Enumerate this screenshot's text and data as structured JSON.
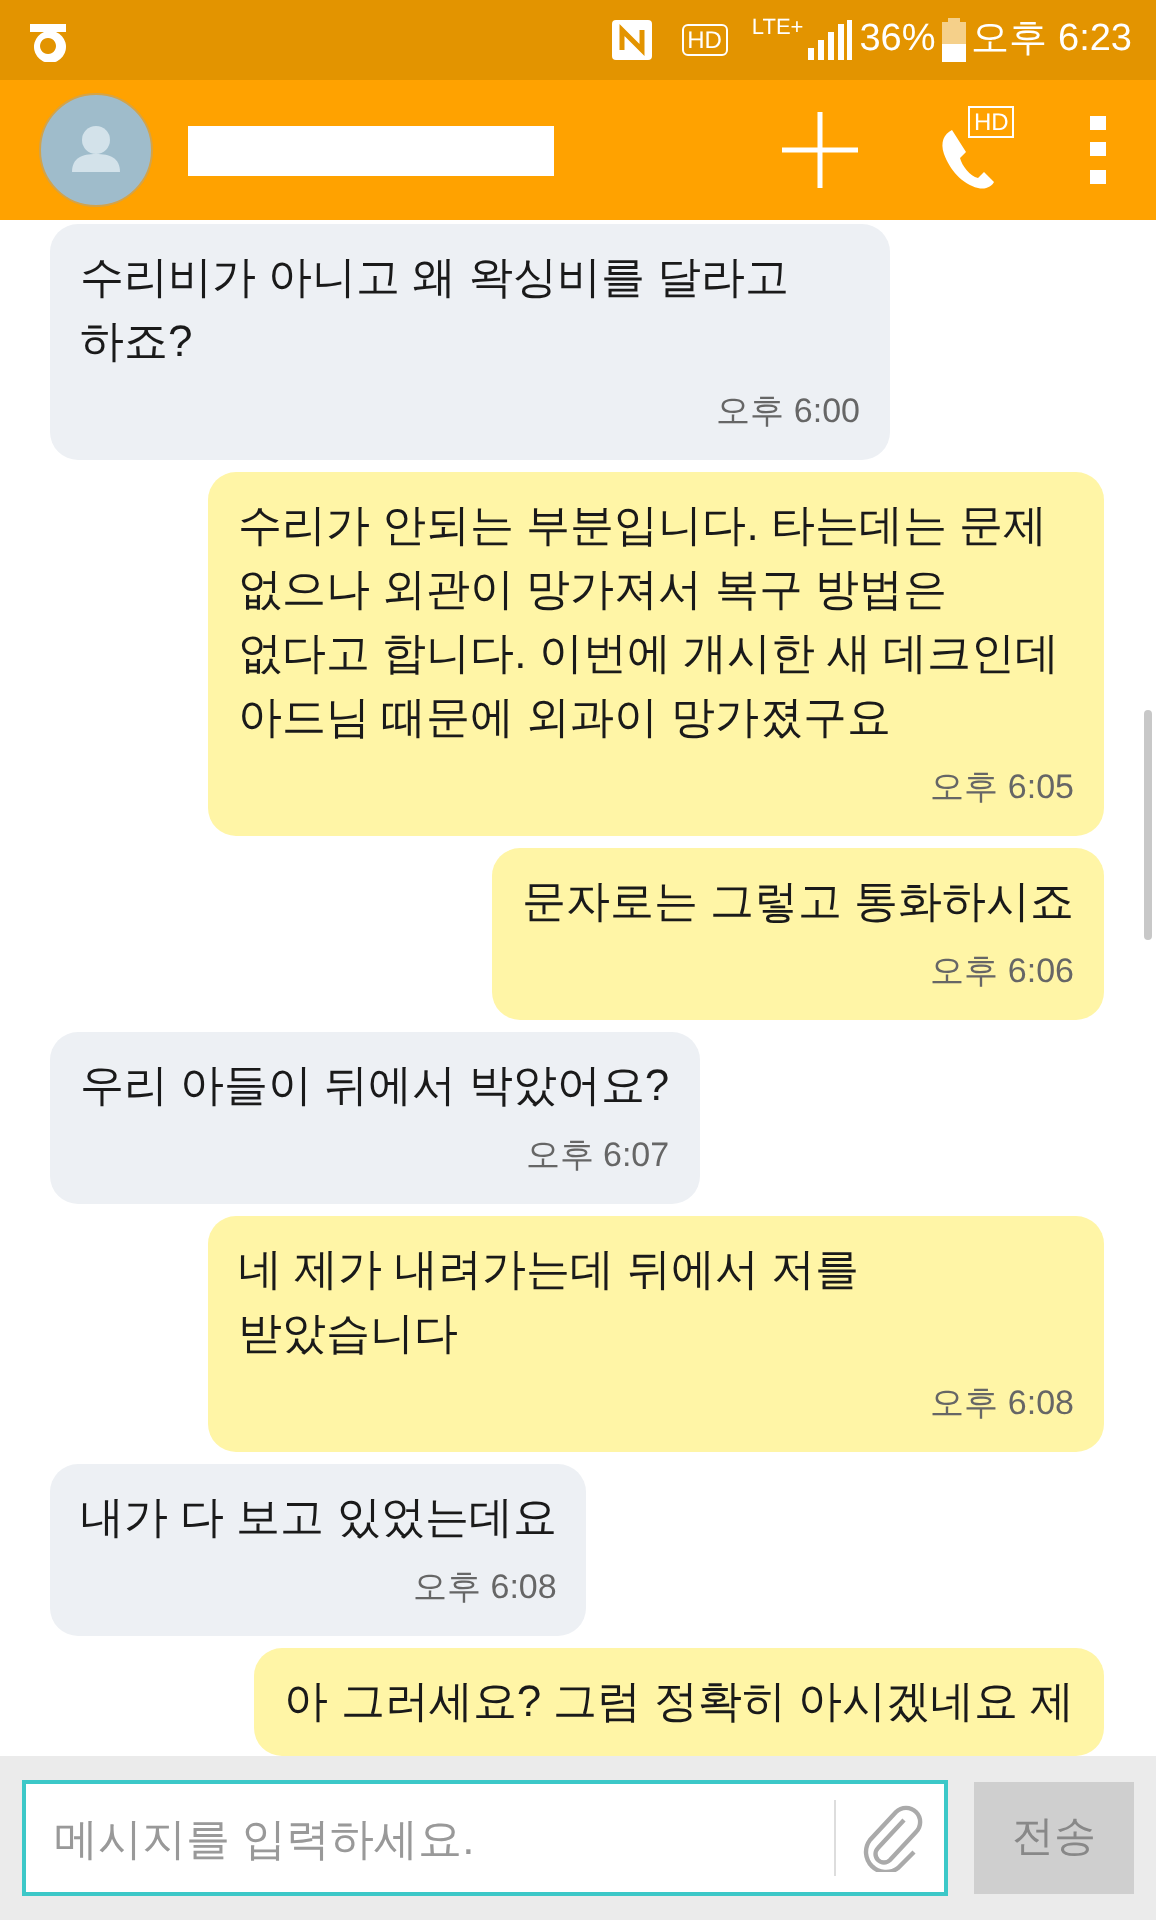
{
  "status_bar": {
    "hd": "HD",
    "network": "LTE+",
    "battery": "36%",
    "time": "오후 6:23"
  },
  "header": {
    "call_badge": "HD"
  },
  "messages": [
    {
      "kind": "received",
      "text": "수리비가 아니고 왜 왁싱비를 달라고 하죠?",
      "time": "오후 6:00"
    },
    {
      "kind": "sent",
      "text": "수리가 안되는 부분입니다. 타는데는 문제 없으나 외관이 망가져서 복구 방법은 없다고 합니다. 이번에 개시한 새 데크인데 아드님 때문에 외과이 망가졌구요",
      "time": "오후 6:05"
    },
    {
      "kind": "sent",
      "text": "문자로는 그렇고 통화하시죠",
      "time": "오후 6:06"
    },
    {
      "kind": "received",
      "text": "우리 아들이 뒤에서 박았어요?",
      "time": "오후 6:07"
    },
    {
      "kind": "sent",
      "text": "네 제가 내려가는데 뒤에서 저를 받았습니다",
      "time": "오후 6:08"
    },
    {
      "kind": "received",
      "text": "내가 다 보고 있었는데요",
      "time": "오후 6:08"
    },
    {
      "kind": "sent",
      "text": "아 그러세요? 그럼 정확히 아시겠네요 제"
    }
  ],
  "composer": {
    "placeholder": "메시지를 입력하세요.",
    "send": "전송"
  }
}
